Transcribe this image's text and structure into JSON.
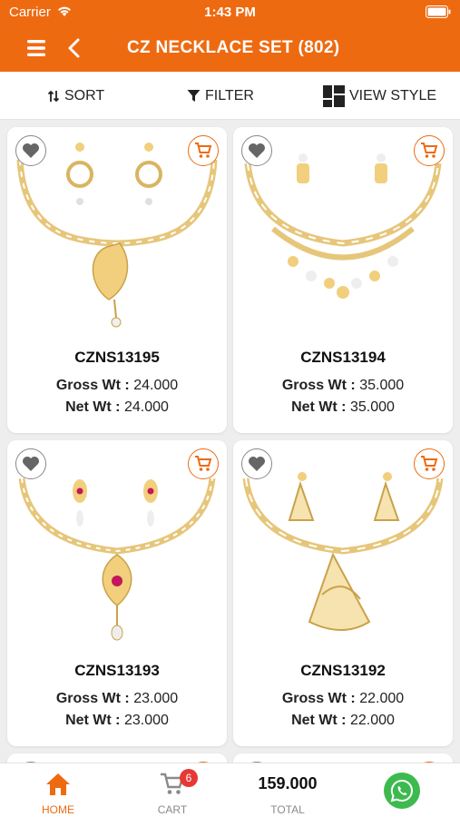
{
  "status_bar": {
    "carrier": "Carrier",
    "time": "1:43 PM"
  },
  "header": {
    "title": "CZ NECKLACE SET (802)"
  },
  "toolbar": {
    "sort_label": "SORT",
    "filter_label": "FILTER",
    "view_label": "VIEW STYLE"
  },
  "products": [
    {
      "code": "CZNS13195",
      "gross_label": "Gross Wt :",
      "gross": "24.000",
      "net_label": "Net Wt :",
      "net": "24.000"
    },
    {
      "code": "CZNS13194",
      "gross_label": "Gross Wt :",
      "gross": "35.000",
      "net_label": "Net Wt :",
      "net": "35.000"
    },
    {
      "code": "CZNS13193",
      "gross_label": "Gross Wt :",
      "gross": "23.000",
      "net_label": "Net Wt :",
      "net": "23.000"
    },
    {
      "code": "CZNS13192",
      "gross_label": "Gross Wt :",
      "gross": "22.000",
      "net_label": "Net Wt :",
      "net": "22.000"
    }
  ],
  "bottom_nav": {
    "home_label": "HOME",
    "cart_label": "CART",
    "cart_count": "6",
    "total_value": "159.000",
    "total_label": "TOTAL"
  },
  "icons": [
    "menu-icon",
    "back-icon",
    "sort-icon",
    "filter-icon",
    "grid-icon",
    "heart-icon",
    "cart-icon",
    "home-icon",
    "whatsapp-icon"
  ],
  "colors": {
    "brand": "#ee6a11",
    "badge": "#e53935",
    "whatsapp": "#3dba4e"
  }
}
